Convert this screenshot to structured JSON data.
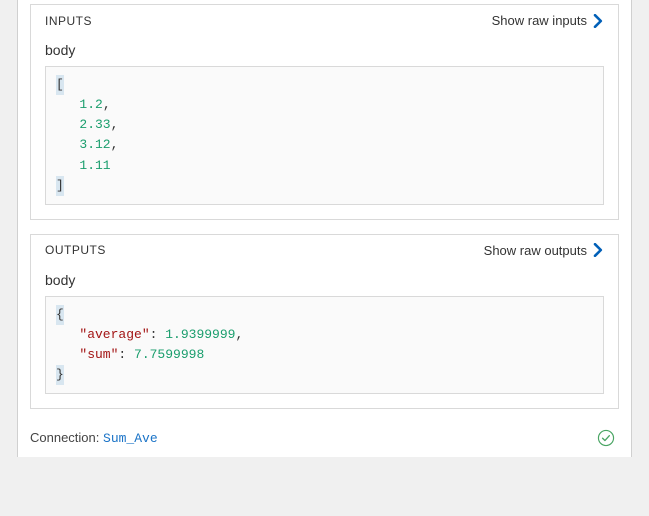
{
  "inputs": {
    "title": "INPUTS",
    "show_raw_label": "Show raw inputs",
    "body_label": "body",
    "body_json": [
      1.2,
      2.33,
      3.12,
      1.11
    ],
    "body_display": {
      "open": "[",
      "lines": [
        "1.2",
        "2.33",
        "3.12",
        "1.11"
      ],
      "close": "]"
    }
  },
  "outputs": {
    "title": "OUTPUTS",
    "show_raw_label": "Show raw outputs",
    "body_label": "body",
    "body_json": {
      "average": 1.9399999,
      "sum": 7.7599998
    },
    "body_display": {
      "open": "{",
      "entries": [
        {
          "key": "\"average\"",
          "value": "1.9399999",
          "trailing_comma": true
        },
        {
          "key": "\"sum\"",
          "value": "7.7599998",
          "trailing_comma": false
        }
      ],
      "close": "}"
    }
  },
  "connection": {
    "label": "Connection:",
    "name": "Sum_Ave"
  },
  "status": "success",
  "colors": {
    "chevron": "#0160b8",
    "status_stroke": "#4aa564"
  }
}
